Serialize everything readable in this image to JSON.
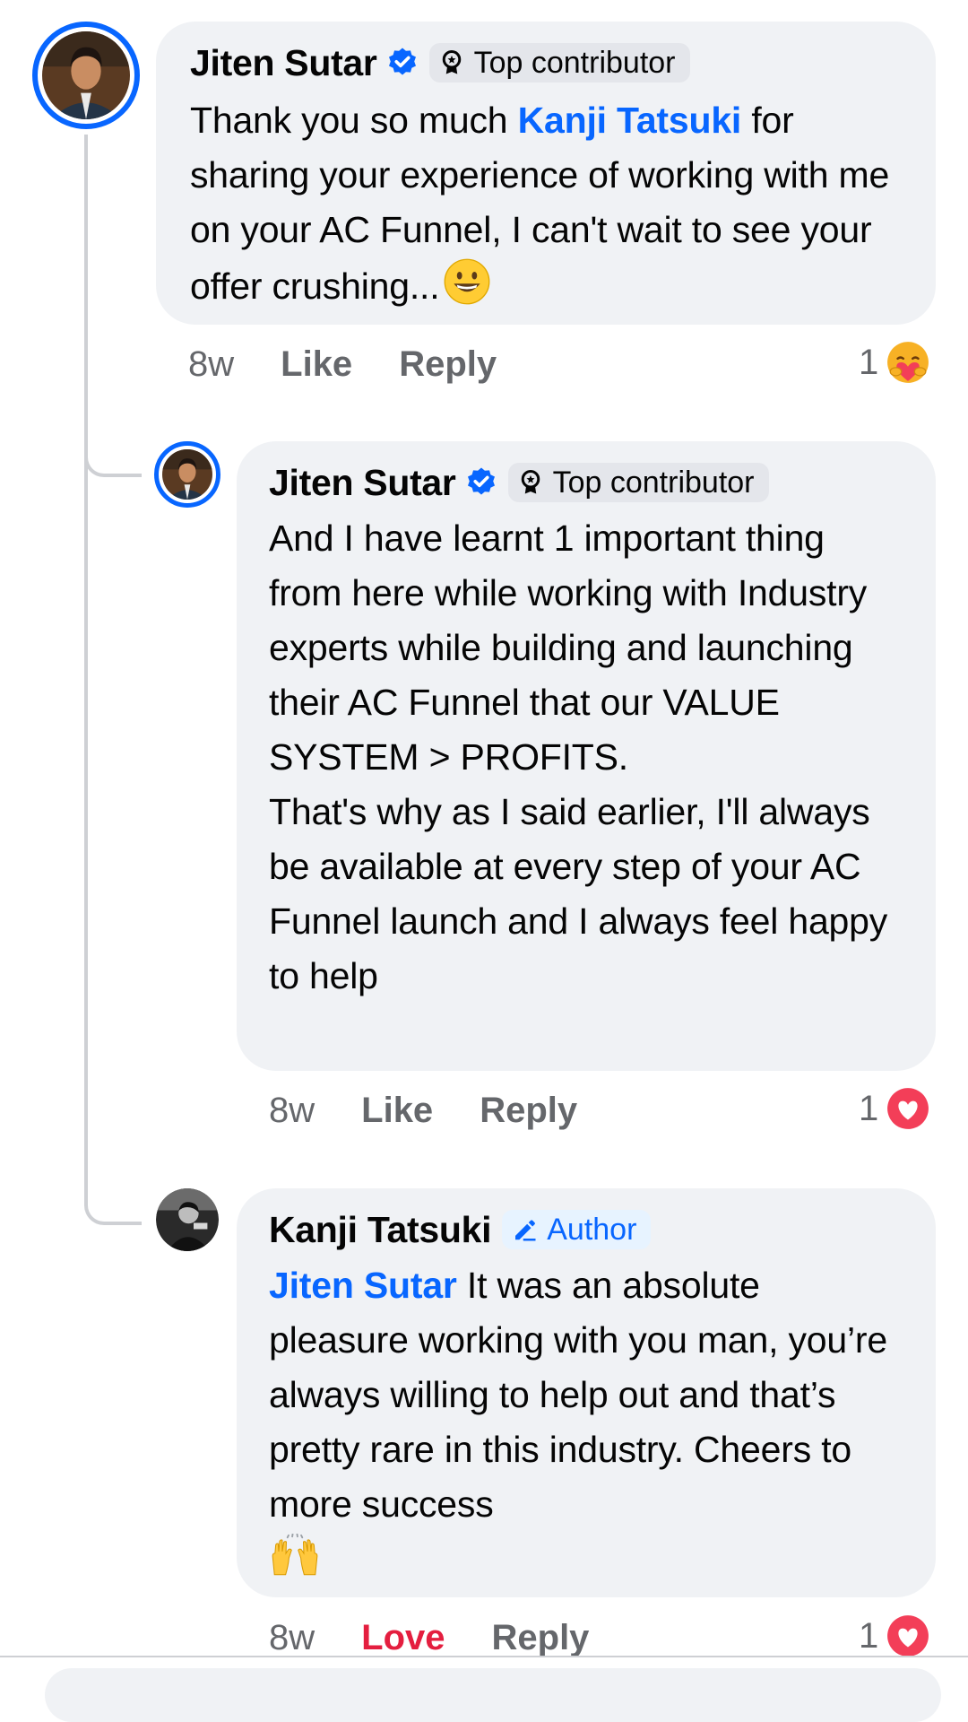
{
  "comments": [
    {
      "author": "Jiten Sutar",
      "badge": "Top contributor",
      "text_before": "Thank you so much ",
      "mention": "Kanji Tatsuki",
      "text_after": " for sharing your experience of working with me on your AC Funnel, I can't wait to see your offer crushing...",
      "time": "8w",
      "like": "Like",
      "reply": "Reply",
      "reaction_count": "1",
      "reaction_icon": "care-icon"
    },
    {
      "author": "Jiten Sutar",
      "badge": "Top contributor",
      "text": "And I have learnt 1 important thing from here while working with Industry experts while building and launching their AC Funnel that our VALUE SYSTEM > PROFITS.\nThat's why as I said earlier, I'll always be available at every step of your AC Funnel launch and I always feel happy to help",
      "time": "8w",
      "like": "Like",
      "reply": "Reply",
      "reaction_count": "1",
      "reaction_icon": "love-icon"
    },
    {
      "author": "Kanji Tatsuki",
      "badge": "Author",
      "mention": "Jiten Sutar",
      "text_after": " It was an absolute pleasure working with you man, you’re always willing to help out and that’s pretty rare in this industry. Cheers to more success",
      "time": "8w",
      "like": "Love",
      "reply": "Reply",
      "reaction_count": "1",
      "reaction_icon": "love-icon"
    }
  ],
  "colors": {
    "accent": "#0866ff",
    "bubble": "#f0f2f5",
    "meta": "#65676b",
    "love": "#e41e3f"
  }
}
